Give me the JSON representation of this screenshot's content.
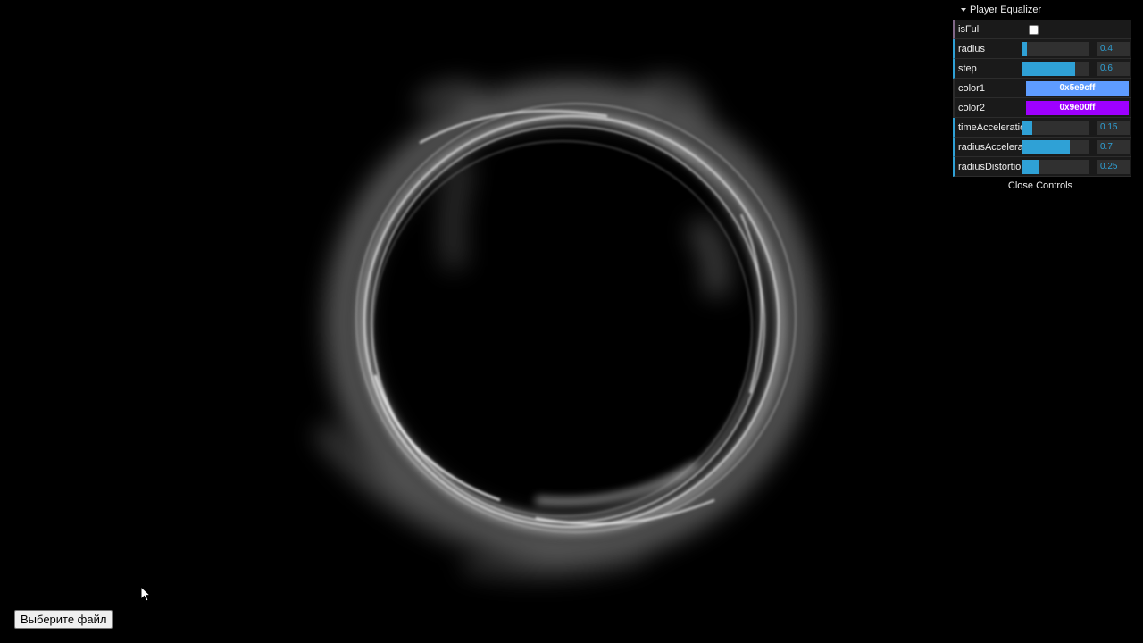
{
  "gui": {
    "title": "Player Equalizer",
    "close_label": "Close Controls",
    "controls": [
      {
        "type": "boolean",
        "label": "isFull",
        "checked": false
      },
      {
        "type": "number",
        "label": "radius",
        "value": "0.4",
        "fraction": 0.06
      },
      {
        "type": "number",
        "label": "step",
        "value": "0.6",
        "fraction": 0.78
      },
      {
        "type": "color",
        "label": "color1",
        "value": "0x5e9cff",
        "color": "#5e9cff"
      },
      {
        "type": "color",
        "label": "color2",
        "value": "0x9e00ff",
        "color": "#9e00ff"
      },
      {
        "type": "number",
        "label": "timeAcceleration",
        "value": "0.15",
        "fraction": 0.15
      },
      {
        "type": "number",
        "label": "radiusAcceleration",
        "value": "0.7",
        "fraction": 0.7
      },
      {
        "type": "number",
        "label": "radiusDistortion",
        "value": "0.25",
        "fraction": 0.25
      }
    ]
  },
  "file_input": {
    "button_label": "Выберите файл"
  }
}
